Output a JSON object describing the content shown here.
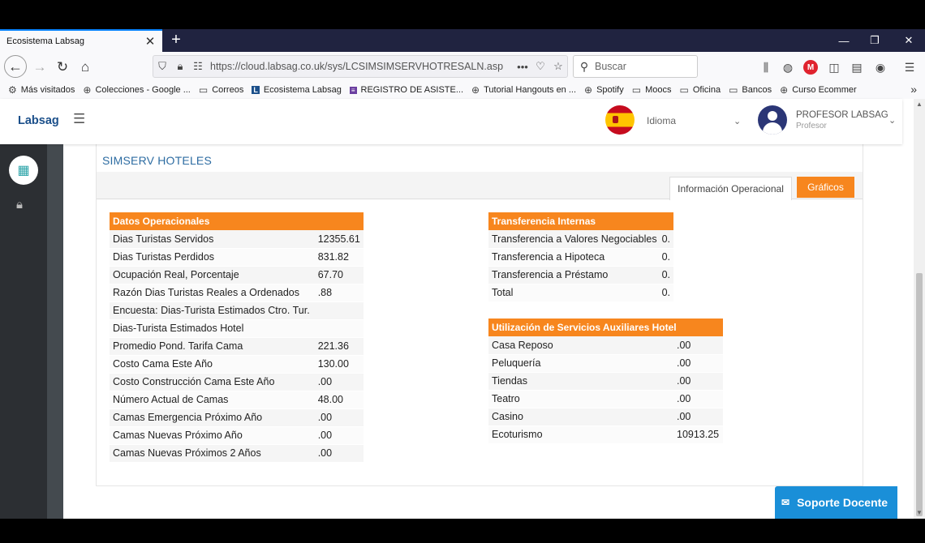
{
  "browser": {
    "tab_title": "Ecosistema Labsag",
    "tab_close": "✕",
    "new_tab": "+",
    "window_controls": [
      "—",
      "❐",
      "✕"
    ],
    "url": "https://cloud.labsag.co.uk/sys/LCSIMSIMSERVHOTRESALN.asp",
    "search_placeholder": "Buscar",
    "bookmarks": [
      {
        "label": "Más visitados",
        "icon": "gear-icon"
      },
      {
        "label": "Colecciones - Google ...",
        "icon": "globe-icon"
      },
      {
        "label": "Correos",
        "icon": "folder-icon"
      },
      {
        "label": "Ecosistema Labsag",
        "icon": "labsag-icon"
      },
      {
        "label": "REGISTRO DE ASISTE...",
        "icon": "form-icon"
      },
      {
        "label": "Tutorial Hangouts en ...",
        "icon": "globe-icon"
      },
      {
        "label": "Spotify",
        "icon": "globe-icon"
      },
      {
        "label": "Moocs",
        "icon": "folder-icon"
      },
      {
        "label": "Oficina",
        "icon": "folder-icon"
      },
      {
        "label": "Bancos",
        "icon": "folder-icon"
      },
      {
        "label": "Curso Ecommer",
        "icon": "globe-icon"
      }
    ]
  },
  "app": {
    "brand": "Labsag",
    "language_label": "Idioma",
    "user_name": "PROFESOR LABSAG",
    "user_role": "Profesor",
    "support_label": "Soporte Docente"
  },
  "page": {
    "title": "SIMSERV HOTELES",
    "tabs": [
      "Información Operacional",
      "Gráficos"
    ]
  },
  "datos": {
    "header": "Datos Operacionales",
    "rows": [
      [
        "Dias Turistas Servidos",
        "12355.61"
      ],
      [
        "Dias Turistas Perdidos",
        "831.82"
      ],
      [
        "Ocupación Real, Porcentaje",
        "67.70"
      ],
      [
        "Razón Dias Turistas Reales a Ordenados",
        ".88"
      ],
      [
        "Encuesta: Dias-Turista Estimados Ctro. Tur.",
        ""
      ],
      [
        "Dias-Turista Estimados Hotel",
        ""
      ],
      [
        "Promedio Pond. Tarifa Cama",
        "221.36"
      ],
      [
        "Costo Cama Este Año",
        "130.00"
      ],
      [
        "Costo Construcción Cama Este Año",
        ".00"
      ],
      [
        "Número Actual de Camas",
        "48.00"
      ],
      [
        "Camas Emergencia Próximo Año",
        ".00"
      ],
      [
        "Camas Nuevas Próximo Año",
        ".00"
      ],
      [
        "Camas Nuevas Próximos 2 Años",
        ".00"
      ]
    ]
  },
  "transferencias": {
    "header": "Transferencia Internas",
    "rows": [
      [
        "Transferencia a Valores Negociables",
        "0."
      ],
      [
        "Transferencia a Hipoteca",
        "0."
      ],
      [
        "Transferencia a Préstamo",
        "0."
      ],
      [
        "Total",
        "0."
      ]
    ]
  },
  "auxiliares": {
    "header": "Utilización de Servicios Auxiliares Hotel",
    "rows": [
      [
        "Casa Reposo",
        ".00"
      ],
      [
        "Peluquería",
        ".00"
      ],
      [
        "Tiendas",
        ".00"
      ],
      [
        "Teatro",
        ".00"
      ],
      [
        "Casino",
        ".00"
      ],
      [
        "Ecoturismo",
        "10913.25"
      ]
    ]
  },
  "colors": {
    "accent": "#f7861e",
    "brand": "#1b4f8a",
    "support": "#1a8fd8"
  }
}
